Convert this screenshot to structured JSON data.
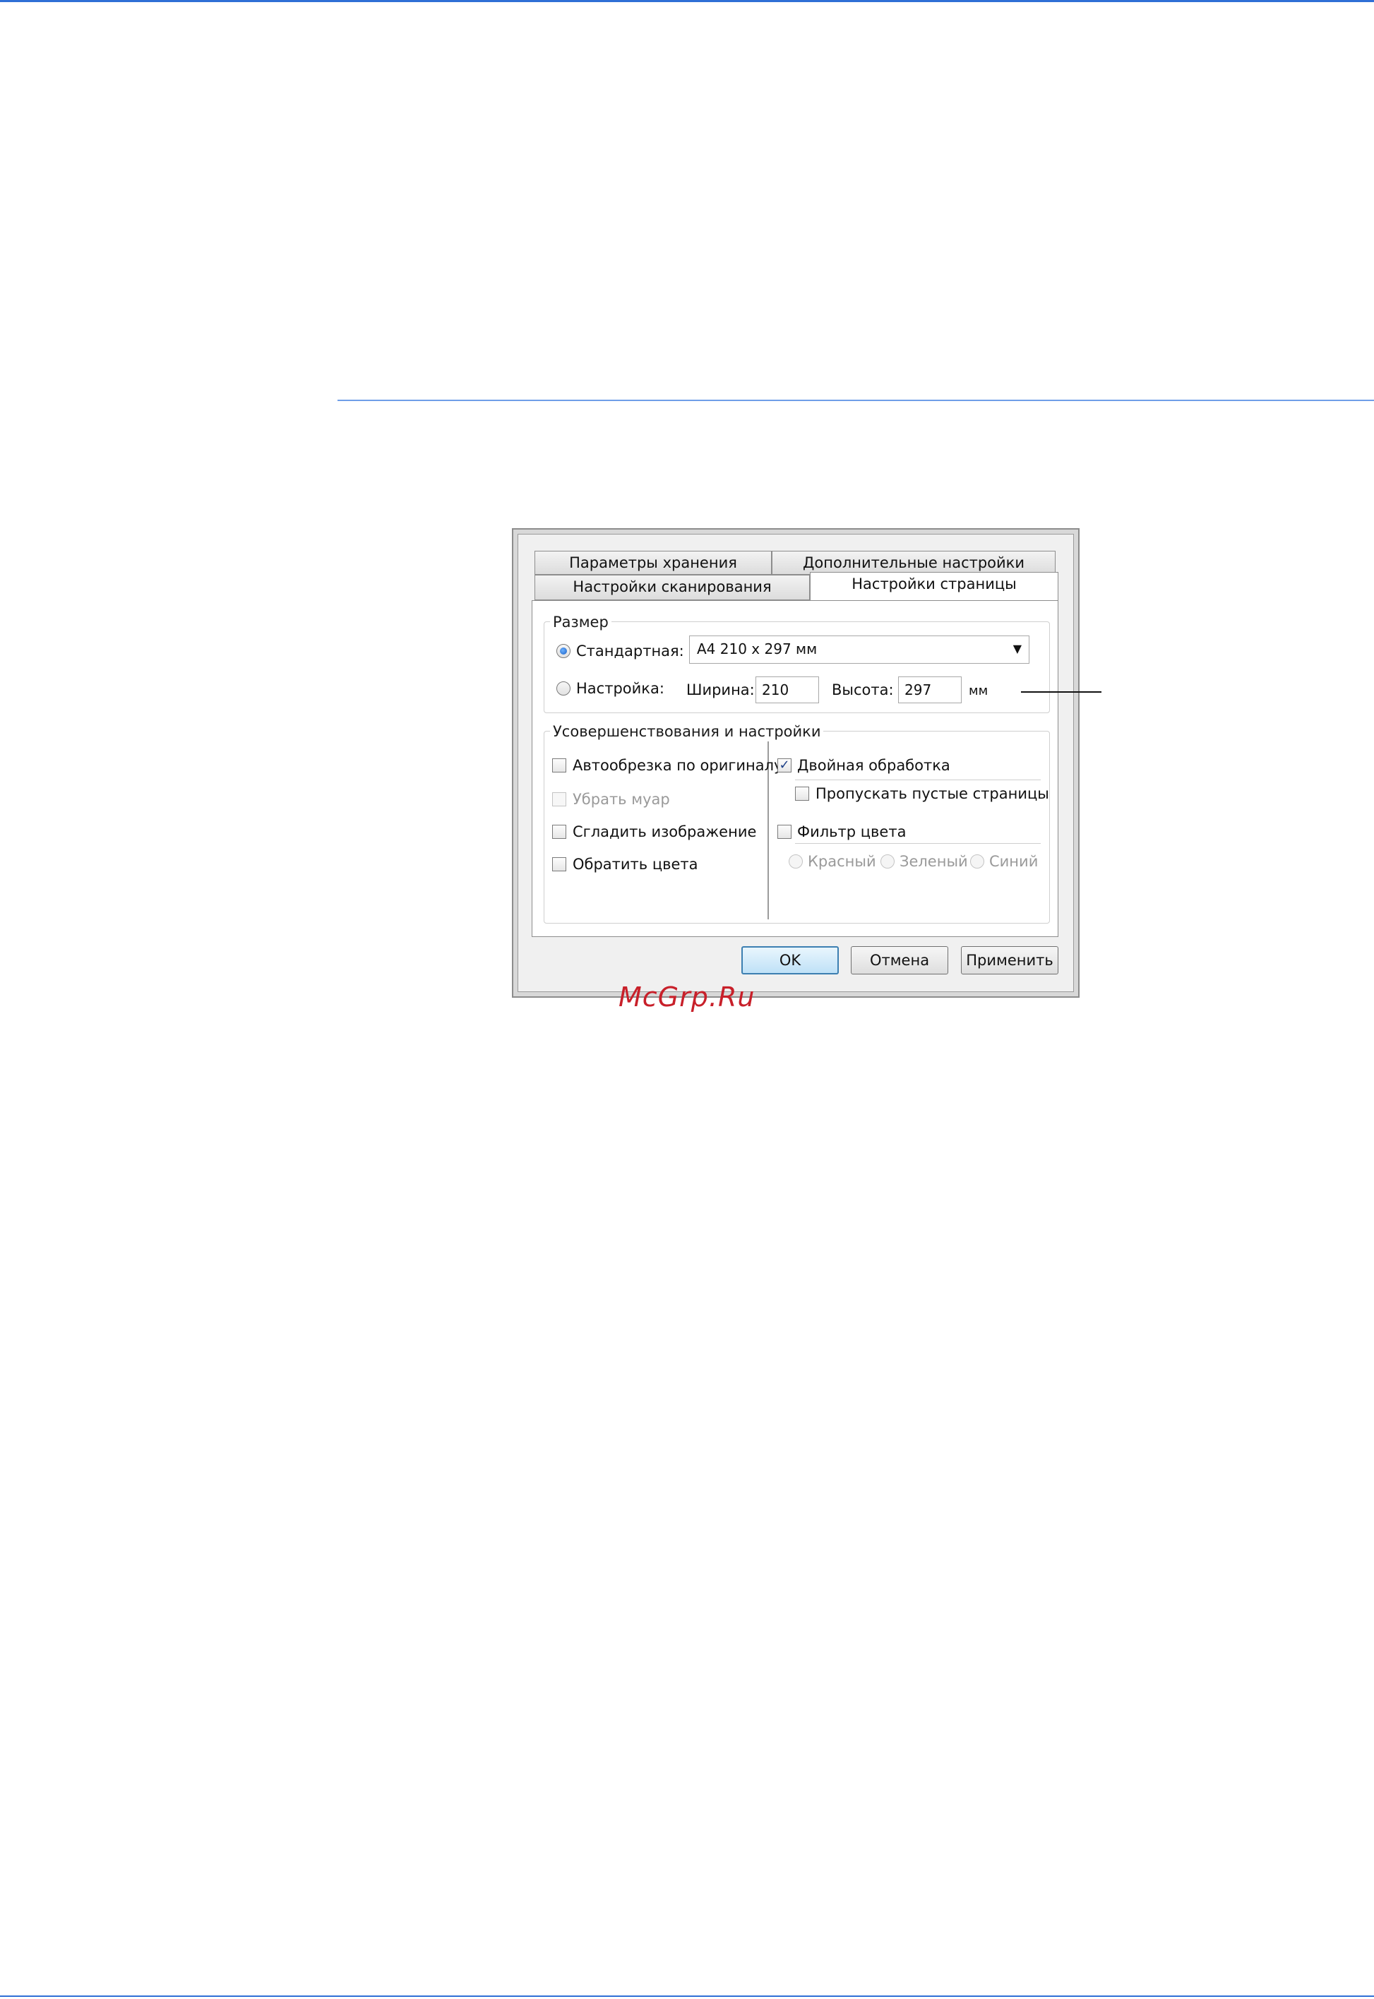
{
  "colors": {
    "rule": "#2f6fd6",
    "watermark": "#c8202a",
    "default_button": "#3c7fb1"
  },
  "tabs": {
    "row1": [
      "Параметры хранения",
      "Дополнительные настройки"
    ],
    "row2": [
      "Настройки сканирования",
      "Настройки страницы"
    ],
    "active": "Настройки страницы"
  },
  "size_group": {
    "legend": "Размер",
    "standard_label": "Стандартная:",
    "standard_selected": true,
    "standard_value": "A4 210 x 297 мм",
    "custom_label": "Настройка:",
    "width_label": "Ширина:",
    "width_value": "210",
    "height_label": "Высота:",
    "height_value": "297",
    "unit": "мм"
  },
  "enhance_group": {
    "legend": "Усовершенствования и настройки",
    "left": [
      {
        "label": "Автообрезка по оригиналу",
        "checked": false,
        "disabled": false
      },
      {
        "label": "Убрать муар",
        "checked": false,
        "disabled": true
      },
      {
        "label": "Сгладить изображение",
        "checked": false,
        "disabled": false
      },
      {
        "label": "Обратить цвета",
        "checked": false,
        "disabled": false
      }
    ],
    "duplex_label": "Двойная обработка",
    "duplex_checked": true,
    "skip_blank_label": "Пропускать пустые страницы",
    "color_filter_label": "Фильтр цвета",
    "colors": [
      "Красный",
      "Зеленый",
      "Синий"
    ]
  },
  "buttons": {
    "ok": "OK",
    "cancel": "Отмена",
    "apply": "Применить"
  },
  "watermark": "McGrp.Ru"
}
